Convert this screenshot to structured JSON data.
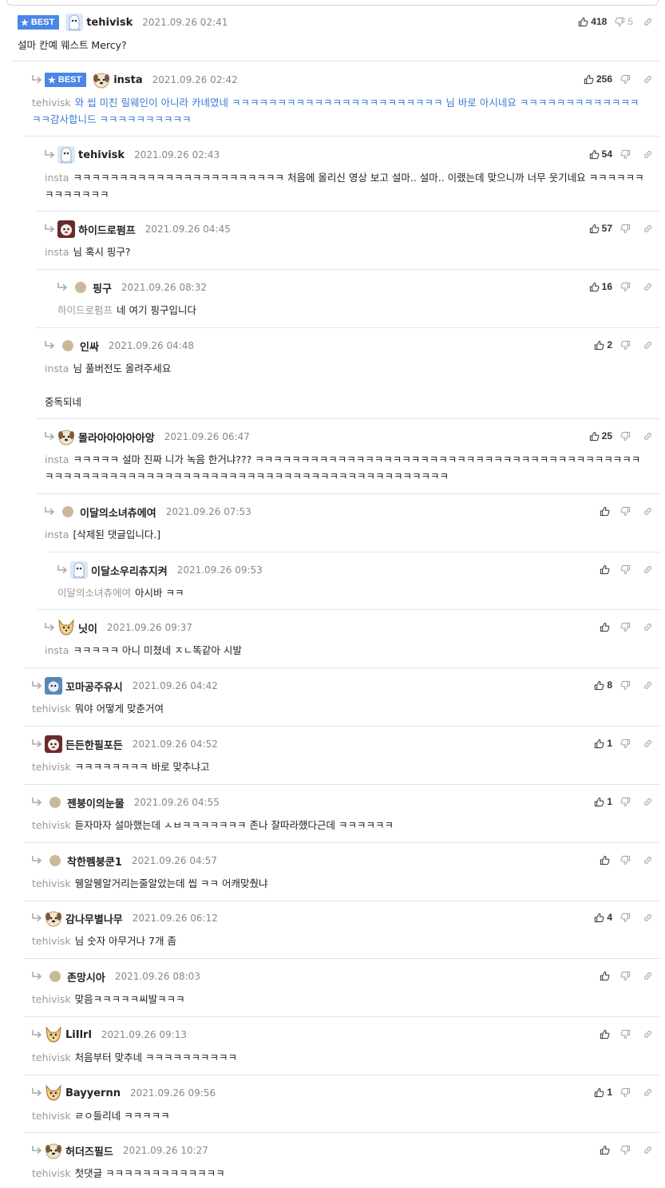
{
  "comments": [
    {
      "best": true,
      "nick": "tehivisk",
      "date": "2021.09.26 02:41",
      "to": "",
      "text": "설마 칸예 웨스트 Mercy?",
      "up": "418",
      "down": "5",
      "avatar": "ghost"
    },
    {
      "best": true,
      "nick": "insta",
      "date": "2021.09.26 02:42",
      "to": "tehivisk",
      "text": "와 씹 미친 릴웨인이 아니라 카녜였네 ㅋㅋㅋㅋㅋㅋㅋㅋㅋㅋㅋㅋㅋㅋㅋㅋㅋㅋㅋㅋㅋㅋㅋ 님 바로 아시네요 ㅋㅋㅋㅋㅋㅋㅋㅋㅋㅋㅋㅋㅋㅋㅋ감사합니드 ㅋㅋㅋㅋㅋㅋㅋㅋㅋㅋ",
      "up": "256",
      "down": "",
      "avatar": "dog"
    },
    {
      "best": false,
      "nick": "tehivisk",
      "date": "2021.09.26 02:43",
      "to": "insta",
      "text": "ㅋㅋㅋㅋㅋㅋㅋㅋㅋㅋㅋㅋㅋㅋㅋㅋㅋㅋㅋㅋㅋㅋㅋ 처음에 올리신 영상 보고 설마.. 설마.. 이랬는데 맞으니까 너무 웃기네요 ㅋㅋㅋㅋㅋㅋㅋㅋㅋㅋㅋㅋㅋ",
      "up": "54",
      "down": "",
      "avatar": "ghost"
    },
    {
      "best": false,
      "nick": "하이드로펌프",
      "date": "2021.09.26 04:45",
      "to": "insta",
      "text": "님 혹시 핑구?",
      "up": "57",
      "down": "",
      "avatar": "red"
    },
    {
      "best": false,
      "nick": "핑구",
      "date": "2021.09.26 08:32",
      "to": "하이드로펌프",
      "text": "네 여기 핑구입니다",
      "up": "16",
      "down": "",
      "avatar": "dot"
    },
    {
      "best": false,
      "nick": "인싸",
      "date": "2021.09.26 04:48",
      "to": "insta",
      "text": "님 풀버전도 올려주세요\n\n중독되네",
      "up": "2",
      "down": "",
      "avatar": "dot"
    },
    {
      "best": false,
      "nick": "몰라아아아아아앙",
      "date": "2021.09.26 06:47",
      "to": "insta",
      "text": "ㅋㅋㅋㅋㅋ 설마 진짜 니가 녹음 한거냐??? ㅋㅋㅋㅋㅋㅋㅋㅋㅋㅋㅋㅋㅋㅋㅋㅋㅋㅋㅋㅋㅋㅋㅋㅋㅋㅋㅋㅋㅋㅋㅋㅋㅋㅋㅋㅋㅋㅋㅋㅋㅋㅋㅋㅋㅋㅋㅋㅋㅋㅋㅋㅋㅋㅋㅋㅋㅋㅋㅋㅋㅋㅋㅋㅋㅋㅋㅋㅋㅋㅋㅋㅋㅋㅋㅋㅋㅋㅋㅋㅋㅋㅋㅋㅋㅋㅋ",
      "up": "25",
      "down": "",
      "avatar": "dog"
    },
    {
      "best": false,
      "nick": "이달의소녀츄에여",
      "date": "2021.09.26 07:53",
      "to": "insta",
      "text": "[삭제된 댓글입니다.]",
      "up": "",
      "down": "",
      "avatar": "dot"
    },
    {
      "best": false,
      "nick": "이달소우리츄지켜",
      "date": "2021.09.26 09:53",
      "to": "이달의소녀츄에여",
      "text": "아시바 ㅋㅋ",
      "up": "",
      "down": "",
      "avatar": "ghost"
    },
    {
      "best": false,
      "nick": "닛이",
      "date": "2021.09.26 09:37",
      "to": "insta",
      "text": "ㅋㅋㅋㅋㅋ 아니 미쳤네 ㅈㄴ똑같아 시발",
      "up": "",
      "down": "",
      "avatar": "fox"
    },
    {
      "best": false,
      "nick": "꼬마공주유시",
      "date": "2021.09.26 04:42",
      "to": "tehivisk",
      "text": "뭐야 어떻게 맞춘거여",
      "up": "8",
      "down": "",
      "avatar": "blue"
    },
    {
      "best": false,
      "nick": "든든한필포든",
      "date": "2021.09.26 04:52",
      "to": "tehivisk",
      "text": "ㅋㅋㅋㅋㅋㅋㅋㅋ 바로 맞추냐고",
      "up": "1",
      "down": "",
      "avatar": "red"
    },
    {
      "best": false,
      "nick": "젠붕이의눈물",
      "date": "2021.09.26 04:55",
      "to": "tehivisk",
      "text": "듣자마자 설마했는데 ㅅㅂㅋㅋㅋㅋㅋㅋㅋ 존나 잘따라했다근데 ㅋㅋㅋㅋㅋㅋ",
      "up": "1",
      "down": "",
      "avatar": "dot"
    },
    {
      "best": false,
      "nick": "착한펨붕쿤1",
      "date": "2021.09.26 04:57",
      "to": "tehivisk",
      "text": "웽알웽알거리는줄알았는데 씹 ㅋㅋ 어캐맞췄냐",
      "up": "",
      "down": "",
      "avatar": "dot"
    },
    {
      "best": false,
      "nick": "감나무별나무",
      "date": "2021.09.26 06:12",
      "to": "tehivisk",
      "text": "님 숫자 아무거나 7개 좀",
      "up": "4",
      "down": "",
      "avatar": "dog"
    },
    {
      "best": false,
      "nick": "존망시아",
      "date": "2021.09.26 08:03",
      "to": "tehivisk",
      "text": "맞음ㅋㅋㅋㅋㅋ씨발ㅋㅋㅋ",
      "up": "",
      "down": "",
      "avatar": "dot"
    },
    {
      "best": false,
      "nick": "LiIlrl",
      "date": "2021.09.26 09:13",
      "to": "tehivisk",
      "text": "처음부터 맞추네 ㅋㅋㅋㅋㅋㅋㅋㅋㅋㅋ",
      "up": "",
      "down": "",
      "avatar": "fox"
    },
    {
      "best": false,
      "nick": "Bayyernn",
      "date": "2021.09.26 09:56",
      "to": "tehivisk",
      "text": "ㄹㅇ들리네 ㅋㅋㅋㅋㅋ",
      "up": "1",
      "down": "",
      "avatar": "fox"
    },
    {
      "best": false,
      "nick": "허더즈필드",
      "date": "2021.09.26 10:27",
      "to": "tehivisk",
      "text": "첫댓글 ㅋㅋㅋㅋㅋㅋㅋㅋㅋㅋㅋㅋㅋ",
      "up": "",
      "down": "",
      "avatar": "dog"
    }
  ],
  "labels": {
    "best": "BEST"
  },
  "icons": {
    "reply": "reply-arrow-icon",
    "like": "thumbs-up-icon",
    "dislike": "thumbs-down-icon",
    "link": "link-icon"
  },
  "colors": {
    "best_badge": "#4a86e8",
    "best_reply_text": "#3a7bd5",
    "mention": "#999999"
  }
}
